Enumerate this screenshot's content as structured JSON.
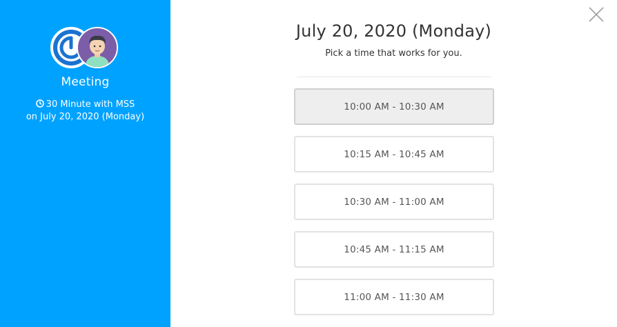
{
  "sidebar": {
    "event_name": "Meeting",
    "duration_text": "30 Minute with MSS",
    "date_text": "on July 20, 2020 (Monday)",
    "icons": {
      "logo": "brand-logo-icon",
      "user": "user-avatar-icon",
      "clock": "clock-icon"
    }
  },
  "main": {
    "title": "July 20, 2020 (Monday)",
    "subtitle": "Pick a time that works for you.",
    "slots": [
      {
        "label": "10:00 AM - 10:30 AM",
        "selected": true
      },
      {
        "label": "10:15 AM - 10:45 AM",
        "selected": false
      },
      {
        "label": "10:30 AM - 11:00 AM",
        "selected": false
      },
      {
        "label": "10:45 AM - 11:15 AM",
        "selected": false
      },
      {
        "label": "11:00 AM - 11:30 AM",
        "selected": false
      }
    ]
  },
  "colors": {
    "sidebar_bg": "#00a2ff",
    "logo_blue": "#1a73d1",
    "avatar_purple": "#7b5ea7"
  }
}
